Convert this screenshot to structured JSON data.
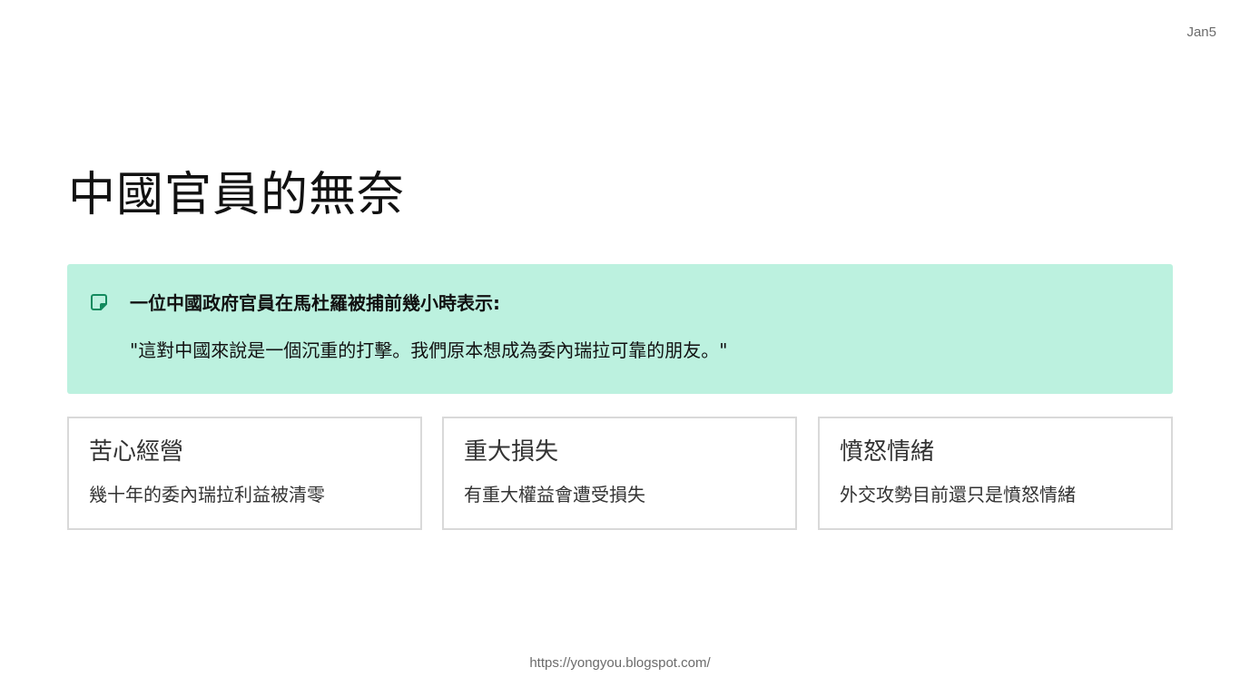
{
  "header": {
    "date": "Jan5"
  },
  "title": "中國官員的無奈",
  "callout": {
    "icon": "note-icon",
    "heading": "一位中國政府官員在馬杜羅被捕前幾小時表示:",
    "quote": "\"這對中國來說是一個沉重的打擊。我們原本想成為委內瑞拉可靠的朋友。\"",
    "background_color": "#bcf1df",
    "icon_color": "#138a5e"
  },
  "cards": [
    {
      "title": "苦心經營",
      "body": "幾十年的委內瑞拉利益被清零"
    },
    {
      "title": "重大損失",
      "body": "有重大權益會遭受損失"
    },
    {
      "title": "憤怒情緒",
      "body": "外交攻勢目前還只是憤怒情緒"
    }
  ],
  "footer": {
    "url": "https://yongyou.blogspot.com/"
  }
}
